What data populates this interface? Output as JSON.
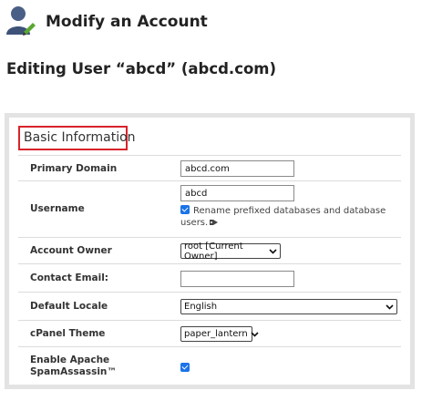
{
  "header": {
    "title": "Modify an Account",
    "icon": "user-edit-icon"
  },
  "subtitle": "Editing User “abcd” (abcd.com)",
  "section": {
    "title": "Basic Information",
    "highlight_color": "#d8232a"
  },
  "fields": {
    "primary_domain": {
      "label": "Primary Domain",
      "value": "abcd.com"
    },
    "username": {
      "label": "Username",
      "value": "abcd",
      "rename_label": "Rename prefixed databases and database users.",
      "rename_checked": true
    },
    "account_owner": {
      "label": "Account Owner",
      "value": "root [Current Owner]"
    },
    "contact_email": {
      "label": "Contact Email:",
      "value": ""
    },
    "default_locale": {
      "label": "Default Locale",
      "value": "English"
    },
    "cpanel_theme": {
      "label": "cPanel Theme",
      "value": "paper_lantern"
    },
    "spamassassin": {
      "label": "Enable Apache SpamAssassin™",
      "checked": true
    }
  },
  "colors": {
    "checkbox": "#1a73e8",
    "panel_bg": "#e3e3e3"
  }
}
